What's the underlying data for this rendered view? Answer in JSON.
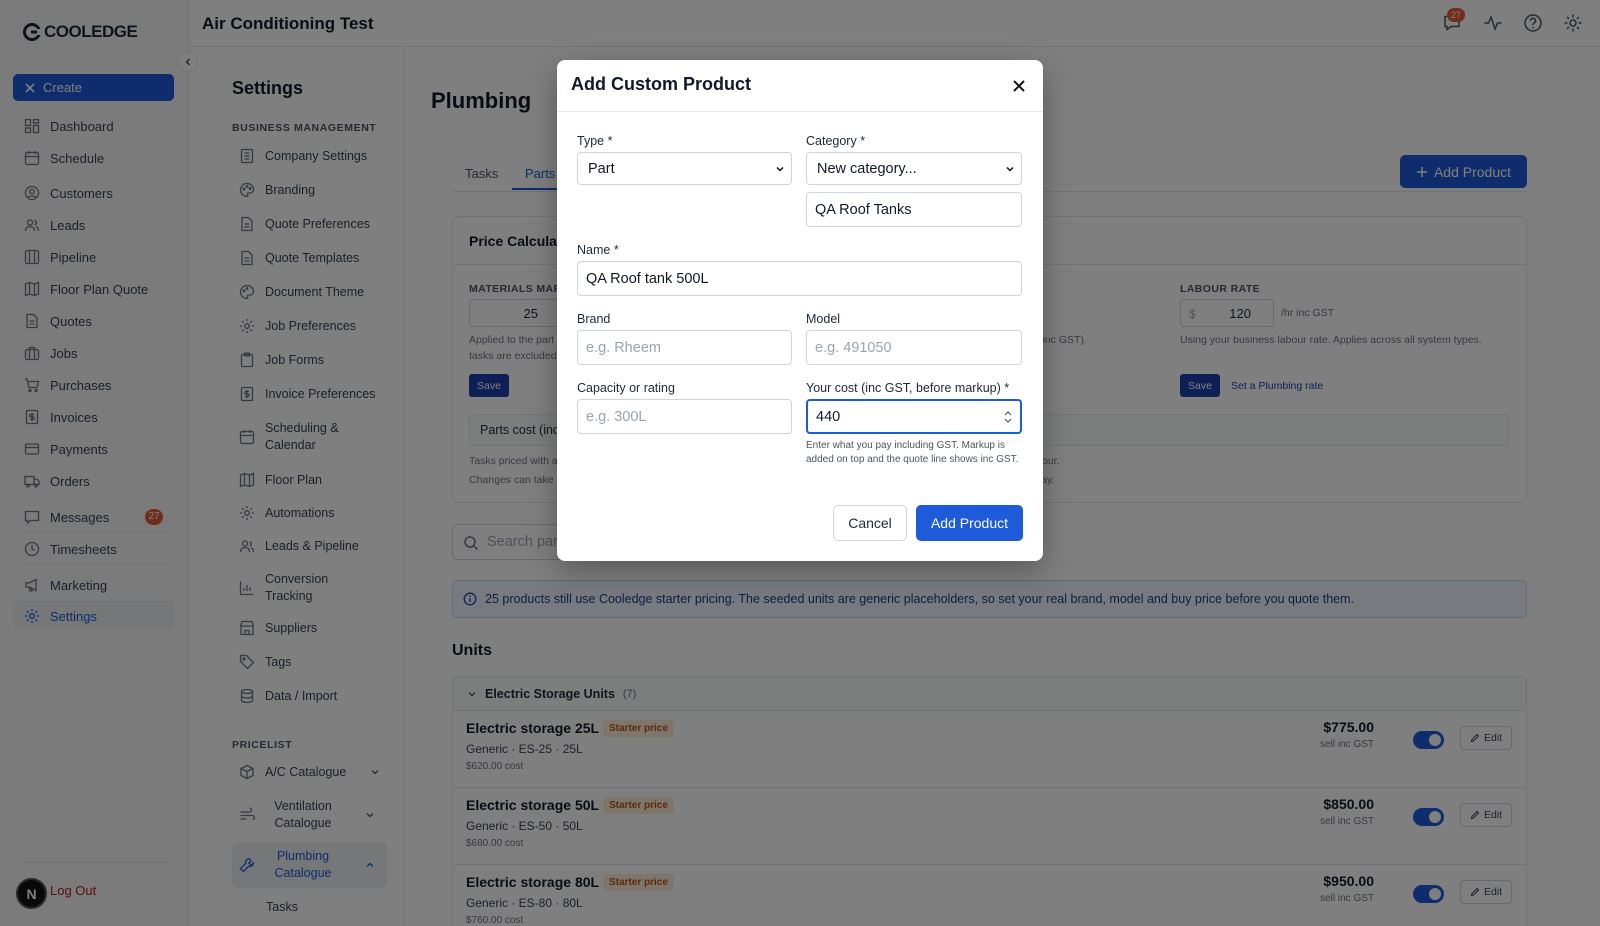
{
  "app": {
    "brand": "COOLEDGE",
    "page_title": "Air Conditioning Test",
    "notifications_count": "27"
  },
  "nav": {
    "create_label": "Create",
    "items": [
      "Dashboard",
      "Schedule",
      "Customers",
      "Leads",
      "Pipeline",
      "Floor Plan Quote",
      "Quotes",
      "Jobs",
      "Purchases",
      "Invoices",
      "Payments",
      "Orders",
      "Messages",
      "Timesheets",
      "Marketing",
      "Settings"
    ],
    "messages_badge": "27",
    "active": "Settings",
    "logout_label": "Log Out",
    "avatar_initial": "N"
  },
  "settings": {
    "title": "Settings",
    "business_label": "BUSINESS MANAGEMENT",
    "business_items": [
      "Company Settings",
      "Branding",
      "Quote Preferences",
      "Quote Templates",
      "Document Theme",
      "Job Preferences",
      "Job Forms",
      "Invoice Preferences",
      "Scheduling & Calendar",
      "Floor Plan",
      "Automations",
      "Leads & Pipeline",
      "Conversion Tracking",
      "Suppliers",
      "Tags",
      "Data / Import"
    ],
    "pricelist_label": "PRICELIST",
    "pricelist_items": [
      "A/C Catalogue",
      "Ventilation Catalogue",
      "Plumbing Catalogue"
    ],
    "sub_item": "Tasks"
  },
  "main": {
    "title": "Plumbing",
    "tabs": [
      "Tasks",
      "Parts"
    ],
    "add_product_label": "Add Product",
    "price_card": {
      "title": "Price Calculat",
      "materials_label": "MATERIALS MAR",
      "materials_value": "25",
      "materials_help_1": "Applied to the part",
      "materials_help_2": "tasks are excluded",
      "mid_help": "(inc GST).",
      "save_label": "Save",
      "labour_label": "LABOUR RATE",
      "labour_prefix": "$",
      "labour_value": "120",
      "labour_suffix": "/hr inc GST",
      "labour_help": "Using your business labour rate. Applies across all system types.",
      "set_rate_label": "Set a Plumbing rate",
      "parts_cost_label": "Parts cost (inc",
      "tasks_note_1": "Tasks priced with a",
      "tasks_note_1_end": "our.",
      "tasks_note_2": "Changes can take",
      "tasks_note_2_end": "ay."
    },
    "search_placeholder": "Search part",
    "banner": "25 products still use Cooledge starter pricing. The seeded units are generic placeholders, so set your real brand, model and buy price before you quote them.",
    "units_title": "Units",
    "group": {
      "name": "Electric Storage Units",
      "count": "(7)"
    },
    "units": [
      {
        "name": "Electric storage 25L",
        "tag": "Starter price",
        "sub": "Generic · ES-25 · 25L",
        "cost": "$620.00 cost",
        "price": "$775.00",
        "price_sub": "sell inc GST",
        "edit": "Edit"
      },
      {
        "name": "Electric storage 50L",
        "tag": "Starter price",
        "sub": "Generic · ES-50 · 50L",
        "cost": "$680.00 cost",
        "price": "$850.00",
        "price_sub": "sell inc GST",
        "edit": "Edit"
      },
      {
        "name": "Electric storage 80L",
        "tag": "Starter price",
        "sub": "Generic · ES-80 · 80L",
        "cost": "$760.00 cost",
        "price": "$950.00",
        "price_sub": "sell inc GST",
        "edit": "Edit"
      }
    ]
  },
  "modal": {
    "title": "Add Custom Product",
    "type_label": "Type *",
    "type_value": "Part",
    "category_label": "Category *",
    "category_value": "New category...",
    "new_category_value": "QA Roof Tanks",
    "name_label": "Name *",
    "name_value": "QA Roof tank 500L",
    "brand_label": "Brand",
    "brand_placeholder": "e.g. Rheem",
    "model_label": "Model",
    "model_placeholder": "e.g. 491050",
    "capacity_label": "Capacity or rating",
    "capacity_placeholder": "e.g. 300L",
    "cost_label": "Your cost (inc GST, before markup) *",
    "cost_value": "440",
    "cost_help": "Enter what you pay including GST. Markup is added on top and the quote line shows inc GST.",
    "cancel_label": "Cancel",
    "submit_label": "Add Product"
  },
  "colors": {
    "primary": "#1e5bd8",
    "badge": "#e25a39",
    "starter_tag_bg": "#fdecd6",
    "starter_tag_text": "#b4531c"
  }
}
